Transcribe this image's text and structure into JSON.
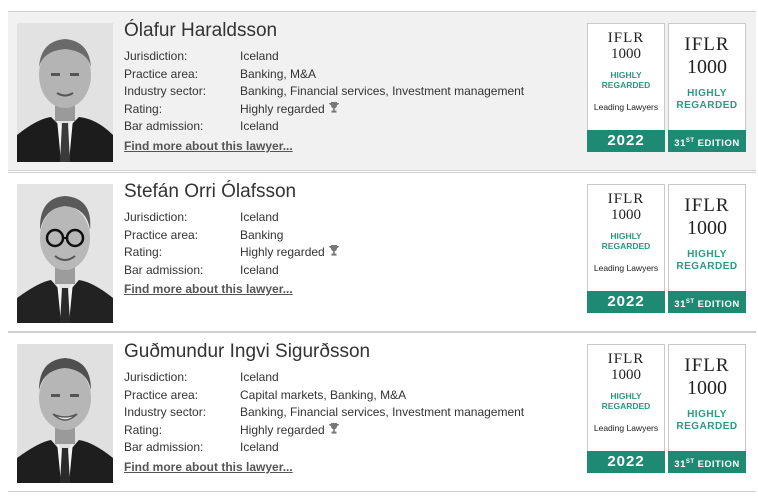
{
  "colors": {
    "accent": "#1f8a73",
    "highlight_text": "#2a9a82"
  },
  "lawyers": [
    {
      "name": "Ólafur Haraldsson",
      "fields": [
        {
          "label": "Jurisdiction:",
          "value": "Iceland"
        },
        {
          "label": "Practice area:",
          "value": "Banking, M&A"
        },
        {
          "label": "Industry sector:",
          "value": "Banking, Financial services, Investment management"
        },
        {
          "label": "Rating:",
          "value": "Highly regarded"
        },
        {
          "label": "Bar admission:",
          "value": "Iceland"
        }
      ],
      "link": "Find more about this lawyer..."
    },
    {
      "name": "Stefán Orri Ólafsson",
      "fields": [
        {
          "label": "Jurisdiction:",
          "value": "Iceland"
        },
        {
          "label": "Practice area:",
          "value": "Banking"
        },
        {
          "label": "Rating:",
          "value": "Highly regarded"
        },
        {
          "label": "Bar admission:",
          "value": "Iceland"
        }
      ],
      "link": "Find more about this lawyer..."
    },
    {
      "name": "Guðmundur Ingvi Sigurðsson",
      "fields": [
        {
          "label": "Jurisdiction:",
          "value": "Iceland"
        },
        {
          "label": "Practice area:",
          "value": "Capital markets, Banking, M&A"
        },
        {
          "label": "Industry sector:",
          "value": "Banking, Financial services, Investment management"
        },
        {
          "label": "Rating:",
          "value": "Highly regarded"
        },
        {
          "label": "Bar admission:",
          "value": "Iceland"
        }
      ],
      "link": "Find more about this lawyer..."
    }
  ],
  "badge": {
    "iflr": "IFLR",
    "number": "1000",
    "highly": "HIGHLY",
    "regarded": "REGARDED",
    "leading": "Leading Lawyers",
    "year": "2022",
    "edition_num": "31",
    "edition_sup": "ST",
    "edition_word": "EDITION"
  },
  "icons": {
    "rating": "trophy-icon"
  }
}
